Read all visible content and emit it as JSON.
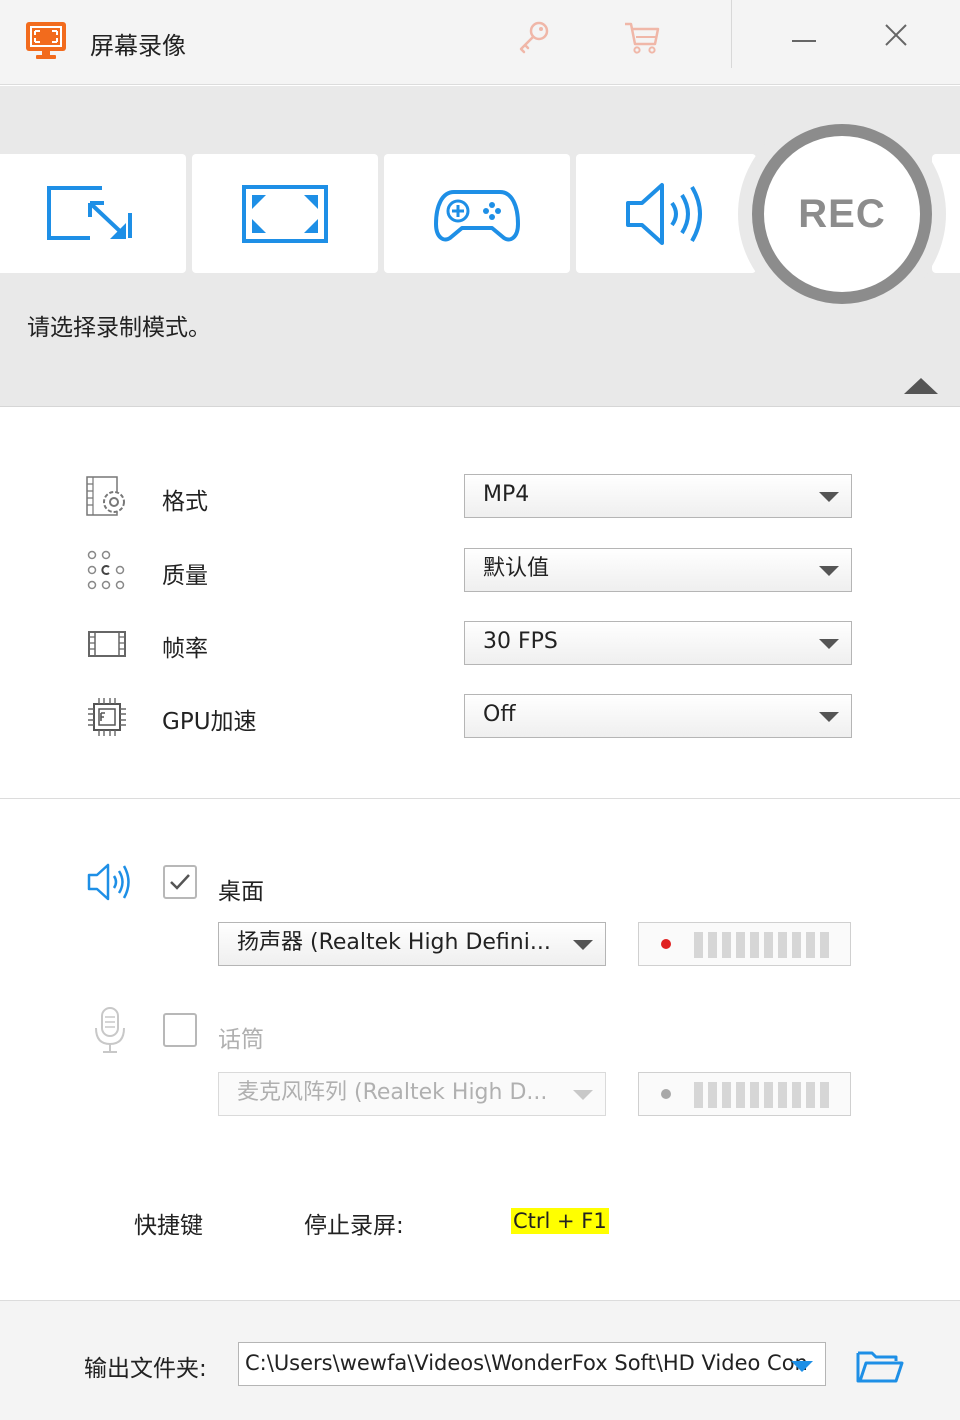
{
  "titlebar": {
    "title": "屏幕录像",
    "icons": [
      "key-icon",
      "cart-icon",
      "minimize-icon",
      "close-icon"
    ]
  },
  "modes": {
    "items": [
      {
        "name": "region-mode",
        "icon": "resize-arrow-icon"
      },
      {
        "name": "fullscreen-mode",
        "icon": "fullscreen-icon"
      },
      {
        "name": "game-mode",
        "icon": "gamepad-icon"
      },
      {
        "name": "audio-only-mode",
        "icon": "speaker-icon"
      }
    ],
    "rec_label": "REC",
    "hint": "请选择录制模式。"
  },
  "settings": {
    "format": {
      "label": "格式",
      "value": "MP4"
    },
    "quality": {
      "label": "质量",
      "value": "默认值"
    },
    "framerate": {
      "label": "帧率",
      "value": "30 FPS"
    },
    "gpu": {
      "label": "GPU加速",
      "value": "Off"
    }
  },
  "audio": {
    "desktop": {
      "label": "桌面",
      "checked": true,
      "device": "扬声器 (Realtek High Defini...",
      "dot_color": "#e02020"
    },
    "mic": {
      "label": "话筒",
      "checked": false,
      "device": "麦克风阵列 (Realtek High D...",
      "dot_color": "#a8a8a8"
    }
  },
  "hotkey": {
    "title": "快捷键",
    "action": "停止录屏:",
    "key": "Ctrl + F1"
  },
  "output": {
    "label": "输出文件夹:",
    "path": "C:\\Users\\wewfa\\Videos\\WonderFox Soft\\HD Video Con"
  },
  "colors": {
    "accent": "#1e8fe6",
    "brand": "#f26b1d",
    "rec_gray": "#8c8c8c",
    "hotkey_highlight": "#ffff00"
  }
}
